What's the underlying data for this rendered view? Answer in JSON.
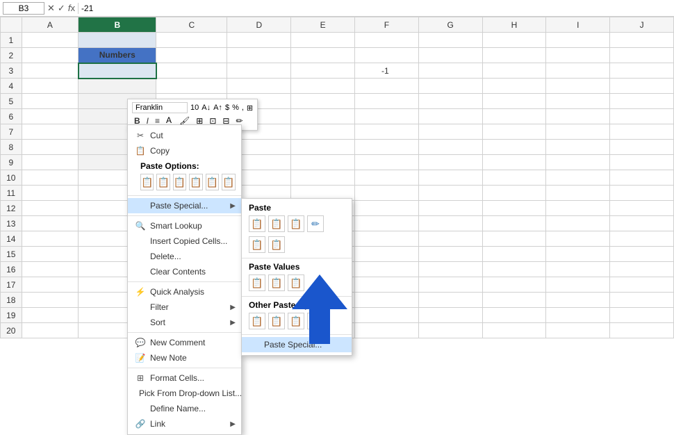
{
  "formula_bar": {
    "cell_ref": "B3",
    "formula_value": "-21",
    "font_name": "Franklin",
    "font_size": "10"
  },
  "columns": [
    "",
    "A",
    "B",
    "C",
    "D",
    "E",
    "F",
    "G",
    "H",
    "I",
    "J"
  ],
  "cell_b2": "Numbers",
  "cell_f3_value": "-1",
  "context_menu": {
    "cut_label": "Cut",
    "copy_label": "Copy",
    "paste_options_label": "Paste Options:",
    "paste_special_label": "Paste Special...",
    "smart_lookup_label": "Smart Lookup",
    "insert_copied_label": "Insert Copied Cells...",
    "delete_label": "Delete...",
    "clear_contents_label": "Clear Contents",
    "quick_analysis_label": "Quick Analysis",
    "filter_label": "Filter",
    "sort_label": "Sort",
    "new_comment_label": "New Comment",
    "new_note_label": "New Note",
    "format_cells_label": "Format Cells...",
    "pick_dropdown_label": "Pick From Drop-down List...",
    "define_name_label": "Define Name...",
    "link_label": "Link"
  },
  "paste_submenu": {
    "paste_label": "Paste",
    "paste_values_label": "Paste Values",
    "other_paste_label": "Other Paste Options",
    "paste_special_label": "Paste Special..."
  }
}
